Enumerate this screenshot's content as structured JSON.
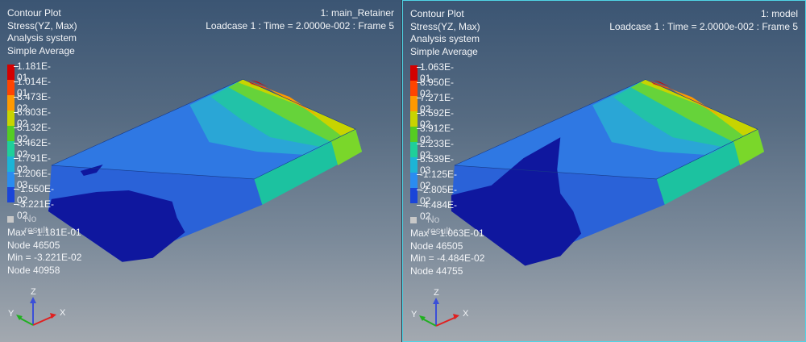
{
  "viewports": [
    {
      "header": {
        "title": "Contour Plot",
        "result": "Stress(YZ, Max)",
        "system": "Analysis system",
        "averaging": "Simple Average",
        "model_name": "1: main_Retainer",
        "loadcase": "Loadcase 1 : Time = 2.0000e-002 : Frame 5"
      },
      "legend": {
        "values": [
          "1.181E-01",
          "1.014E-01",
          "8.473E-02",
          "6.803E-02",
          "5.132E-02",
          "3.462E-02",
          "1.791E-02",
          "1.206E-03",
          "-1.550E-02",
          "-3.221E-02"
        ],
        "no_result": "No result"
      },
      "stats": {
        "max": "Max = 1.181E-01",
        "max_node": "Node 46505",
        "min": "Min = -3.221E-02",
        "min_node": "Node 40958"
      },
      "axes": {
        "z": "Z",
        "y": "Y",
        "x": "X"
      }
    },
    {
      "header": {
        "title": "Contour Plot",
        "result": "Stress(YZ, Max)",
        "system": "Analysis system",
        "averaging": "Simple Average",
        "model_name": "1: model",
        "loadcase": "Loadcase 1 : Time = 2.0000e-002 : Frame 5"
      },
      "legend": {
        "values": [
          "1.063E-01",
          "8.950E-02",
          "7.271E-02",
          "5.592E-02",
          "3.912E-02",
          "2.233E-02",
          "5.539E-03",
          "-1.125E-02",
          "-2.805E-02",
          "-4.484E-02"
        ],
        "no_result": "No result"
      },
      "stats": {
        "max": "Max = 1.063E-01",
        "max_node": "Node 46505",
        "min": "Min = -4.484E-02",
        "min_node": "Node 44755"
      },
      "axes": {
        "z": "Z",
        "y": "Y",
        "x": "X"
      }
    }
  ],
  "colors": {
    "legend_scale": [
      "#d40000",
      "#ff4400",
      "#ff9900",
      "#c8d400",
      "#55cc22",
      "#1fcf9a",
      "#1cb4d6",
      "#2a8cf0",
      "#1a45d8",
      "#0a0f9a"
    ],
    "viewport_active_border": "#4fd4e6",
    "no_result": "#c8c8c8"
  }
}
